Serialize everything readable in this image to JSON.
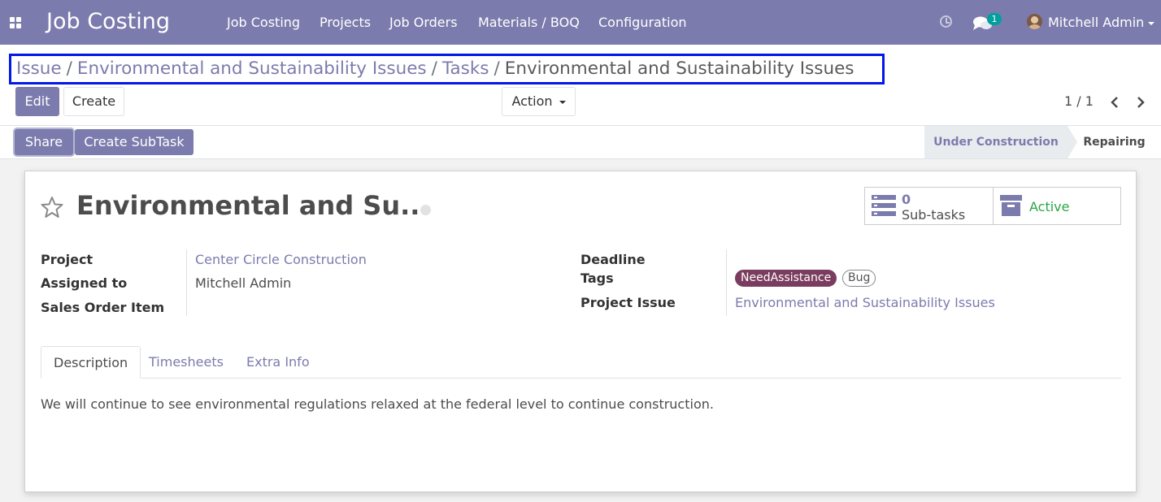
{
  "app": {
    "title": "Job Costing"
  },
  "menu": {
    "job_costing": "Job Costing",
    "projects": "Projects",
    "job_orders": "Job Orders",
    "materials_boq": "Materials / BOQ",
    "configuration": "Configuration"
  },
  "systray": {
    "chat_count": "1",
    "user_name": "Mitchell Admin"
  },
  "breadcrumb": {
    "items": [
      "Issue",
      "Environmental and Sustainability Issues",
      "Tasks"
    ],
    "active": "Environmental and Sustainability Issues",
    "separator": "/"
  },
  "buttons": {
    "edit": "Edit",
    "create": "Create",
    "action": "Action",
    "share": "Share",
    "create_subtask": "Create SubTask"
  },
  "pager": {
    "value": "1 / 1"
  },
  "stages": {
    "inactive": "Under Construction",
    "active": "Repairing"
  },
  "record": {
    "title": "Environmental and Su...",
    "smart_buttons": {
      "subtasks_count": "0",
      "subtasks_label": "Sub-tasks",
      "active_label": "Active"
    },
    "fields": {
      "project_label": "Project",
      "project_value": "Center Circle Construction",
      "assigned_label": "Assigned to",
      "assigned_value": "Mitchell Admin",
      "sales_order_label": "Sales Order Item",
      "deadline_label": "Deadline",
      "tags_label": "Tags",
      "tags": [
        "NeedAssistance",
        "Bug"
      ],
      "project_issue_label": "Project Issue",
      "project_issue_value": "Environmental and Sustainability Issues"
    },
    "tabs": [
      "Description",
      "Timesheets",
      "Extra Info"
    ],
    "description": "We will continue to see environmental regulations relaxed at the federal level to continue construction."
  },
  "colors": {
    "brand": "#7c7bad",
    "highlight_border": "#0019e6",
    "tag_need_assistance": "#7a3d5f",
    "active_green": "#28a745",
    "badge_teal": "#00a09d"
  }
}
